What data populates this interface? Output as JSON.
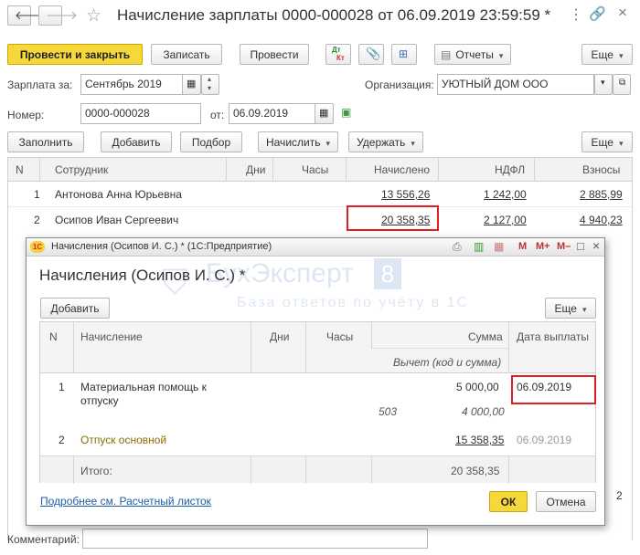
{
  "window": {
    "title": "Начисление зарплаты 0000-000028 от 06.09.2019 23:59:59 *"
  },
  "toolbar": {
    "post_close": "Провести и закрыть",
    "save": "Записать",
    "post": "Провести",
    "dtkt_top": "Дт",
    "dtkt_bottom": "Кт",
    "reports": "Отчеты",
    "more": "Еще"
  },
  "form": {
    "salary_for_label": "Зарплата за:",
    "salary_for_value": "Сентябрь 2019",
    "org_label": "Организация:",
    "org_value": "УЮТНЫЙ ДОМ ООО",
    "number_label": "Номер:",
    "number_value": "0000-000028",
    "from_label": "от:",
    "date_value": "06.09.2019"
  },
  "table_toolbar": {
    "fill": "Заполнить",
    "add": "Добавить",
    "select": "Подбор",
    "accrue": "Начислить",
    "withhold": "Удержать",
    "more": "Еще"
  },
  "main_table": {
    "columns": [
      "N",
      "Сотрудник",
      "Дни",
      "Часы",
      "Начислено",
      "НДФЛ",
      "Взносы"
    ],
    "rows": [
      {
        "n": "1",
        "employee": "Антонова Анна Юрьевна",
        "accrued": "13 556,26",
        "ndfl": "1 242,00",
        "contrib": "2 885,99"
      },
      {
        "n": "2",
        "employee": "Осипов Иван Сергеевич",
        "accrued": "20 358,35",
        "ndfl": "2 127,00",
        "contrib": "4 940,23"
      }
    ]
  },
  "comment_label": "Комментарий:",
  "dialog": {
    "window_title": "Начисления (Осипов И. С.) * (1С:Предприятие)",
    "heading": "Начисления (Осипов И. С.) *",
    "add": "Добавить",
    "more": "Еще",
    "columns": {
      "n": "N",
      "accrual": "Начисление",
      "days": "Дни",
      "hours": "Часы",
      "sum": "Сумма",
      "deduction": "Вычет (код и сумма)",
      "pay_date": "Дата выплаты"
    },
    "rows": [
      {
        "n": "1",
        "name_line1": "Материальная помощь к",
        "name_line2": "отпуску",
        "sum": "5 000,00",
        "ded_code": "503",
        "ded_sum": "4 000,00",
        "pay_date": "06.09.2019"
      },
      {
        "n": "2",
        "name": "Отпуск основной",
        "sum": "15 358,35",
        "pay_date": "06.09.2019"
      }
    ],
    "total_label": "Итого:",
    "total_sum": "20 358,35",
    "payslip_link": "Подробнее см. Расчетный листок",
    "ok": "ОК",
    "cancel": "Отмена",
    "sys_m": "M",
    "sys_mplus": "M+",
    "sys_mminus": "M–"
  },
  "watermark": {
    "brand": "БухЭксперт",
    "digit": "8",
    "tagline": "База ответов по учёту в 1С"
  },
  "partial_value": "2"
}
